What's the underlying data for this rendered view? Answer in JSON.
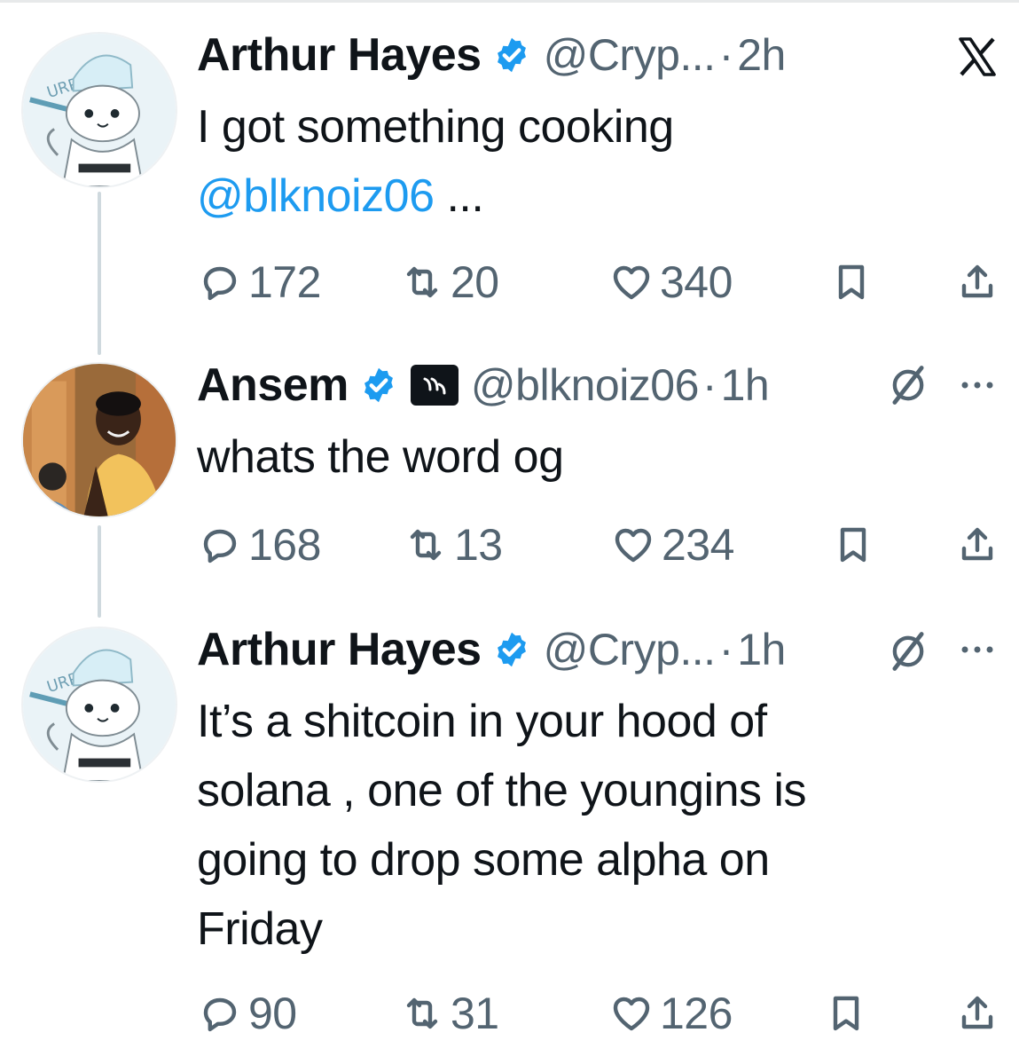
{
  "tweets": [
    {
      "name": "Arthur Hayes",
      "handle": "@Cryp...",
      "separator": "·",
      "time": "2h",
      "text": "I got something cooking",
      "mention": "@blknoiz06",
      "ellipsis": "...",
      "replies": "172",
      "reposts": "20",
      "likes": "340"
    },
    {
      "name": "Ansem",
      "handle": "@blknoiz06",
      "separator": "·",
      "time": "1h",
      "text": "whats the word og",
      "replies": "168",
      "reposts": "13",
      "likes": "234"
    },
    {
      "name": "Arthur Hayes",
      "handle": "@Cryp...",
      "separator": "·",
      "time": "1h",
      "text_lines": [
        "It’s a shitcoin in your hood of",
        "solana , one of the youngins is",
        "going to drop some alpha on",
        "Friday"
      ],
      "replies": "90",
      "reposts": "31",
      "likes": "126"
    }
  ],
  "icons": {
    "verified": "verified-badge-icon",
    "affiliate": "affiliate-badge-icon",
    "reply": "reply-icon",
    "repost": "repost-icon",
    "like": "heart-icon",
    "bookmark": "bookmark-icon",
    "share": "share-icon",
    "logo": "x-logo-icon",
    "grok": "grok-icon",
    "more": "more-icon"
  },
  "colors": {
    "text": "#0f1419",
    "secondary": "#536471",
    "link": "#1d9bf0",
    "verified": "#1d9bf0",
    "thread_line": "#cfd9de"
  }
}
